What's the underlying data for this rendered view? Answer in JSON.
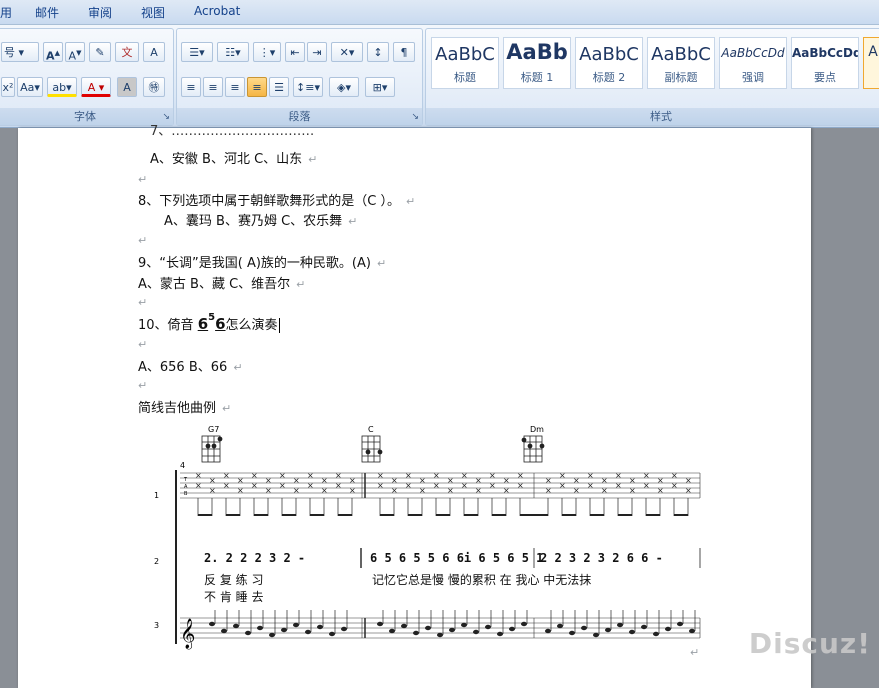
{
  "menu": [
    "用",
    "邮件",
    "审阅",
    "视图",
    "Acrobat"
  ],
  "ribbon": {
    "font_size": "号",
    "font_group": "字体",
    "paragraph_group": "段落",
    "styles_group": "样式",
    "styles": [
      {
        "sample": "AaBbC",
        "name": "标题"
      },
      {
        "sample": "AaBb",
        "name": "标题 1"
      },
      {
        "sample": "AaBbC",
        "name": "标题 2"
      },
      {
        "sample": "AaBbC",
        "name": "副标题"
      },
      {
        "sample": "AaBbCcDd",
        "name": "强调"
      },
      {
        "sample": "AaBbCcDd",
        "name": "要点"
      }
    ]
  },
  "document": {
    "q7_options": "A、安徽 B、河北 C、山东",
    "q8": "8、下列选项中属于朝鲜歌舞形式的是（C   ）。",
    "q8_options": "A、囊玛 B、赛乃姆 C、农乐舞",
    "q9": "9、“长调”是我国(   A)族的一种民歌。(A)",
    "q9_options": "A、蒙古 B、藏 C、维吾尔",
    "q10_prefix": "10、倚音",
    "q10_grace": "5",
    "q10_note": "6",
    "q10_suffix": "怎么演奏",
    "q10_options": "A、656   B、66",
    "section_title": "简线吉他曲例",
    "paragraph_mark": "↵"
  },
  "score": {
    "chords": [
      "G7",
      "C",
      "Dm"
    ],
    "time_sig": "4",
    "staff_numbers": [
      "1",
      "2",
      "3"
    ],
    "tab_labels": [
      "T",
      "A",
      "B"
    ],
    "jianpu_bar1": "2.  2  2  2 3 2    -",
    "jianpu_bar2": "6 5 6 5 5 6 6i 6 5 6 5 1",
    "jianpu_bar3": "2 2 3 2 3 2 6 6    -",
    "lyrics_line1_a": "反  复  练  习",
    "lyrics_line1_b": "记忆它总是慢  慢的累积  在  我心  中无法抹",
    "lyrics_line2": "不  肯  睡  去"
  },
  "watermark": "Discuz!"
}
